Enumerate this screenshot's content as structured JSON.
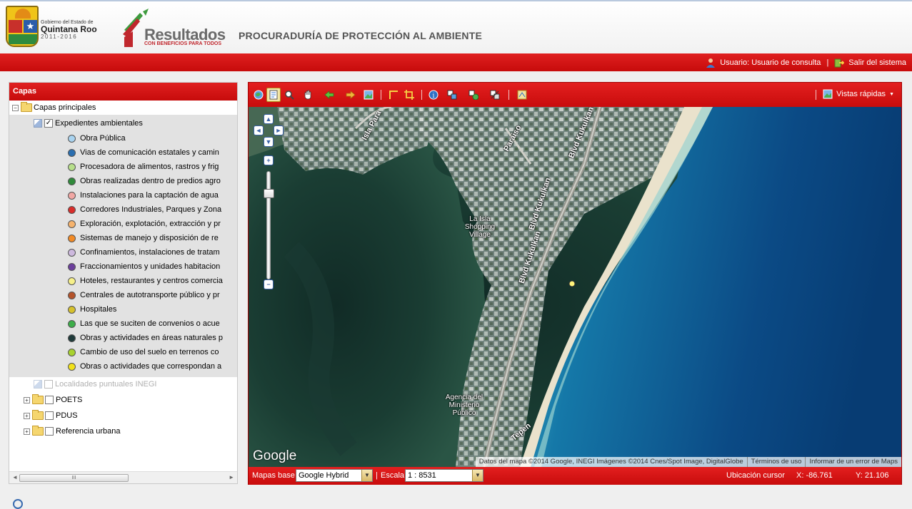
{
  "header": {
    "gov_line1": "Gobierno del Estado de",
    "gov_line2": "Quintana Roo",
    "gov_line3": "2011-2016",
    "brand_title": "Resultados",
    "brand_sub": "CON BENEFICIOS PARA TODOS",
    "agency": "PROCURADURÍA DE PROTECCIÓN AL AMBIENTE"
  },
  "userbar": {
    "user_label": "Usuario: Usuario de consulta",
    "separator": "|",
    "logout_label": "Salir del sistema"
  },
  "layers": {
    "title": "Capas",
    "root": "Capas principales",
    "group": "Expedientes ambientales",
    "items": [
      {
        "label": "Obra Pública",
        "color": "#a9d3ef"
      },
      {
        "label": "Vias de comunicación estatales y camin",
        "color": "#2b6fb0"
      },
      {
        "label": "Procesadora de alimentos, rastros y frig",
        "color": "#b7df8b"
      },
      {
        "label": "Obras realizadas dentro de predios agro",
        "color": "#2f8a3a"
      },
      {
        "label": "Instalaciones para la captación de agua",
        "color": "#f1a7a4"
      },
      {
        "label": "Corredores Industriales, Parques y Zona",
        "color": "#d92d2a"
      },
      {
        "label": "Exploración, explotación, extracción y pr",
        "color": "#f6b36d"
      },
      {
        "label": "Sistemas de manejo y disposición de re",
        "color": "#f28a25"
      },
      {
        "label": "Confinamientos, instalaciones de tratam",
        "color": "#cdb9de"
      },
      {
        "label": "Fraccionamientos y unidades habitacion",
        "color": "#6c3f9c"
      },
      {
        "label": "Hoteles, restaurantes y centros comercia",
        "color": "#f6f08a"
      },
      {
        "label": "Centrales de autotransporte público y pr",
        "color": "#b5532a"
      },
      {
        "label": "Hospitales",
        "color": "#d6c12d"
      },
      {
        "label": "Las que se suciten de convenios o acue",
        "color": "#3dae4a"
      },
      {
        "label": "Obras y actividades en áreas naturales p",
        "color": "#1f3a3a"
      },
      {
        "label": "Cambio de uso del suelo en terrenos co",
        "color": "#a8d22e"
      },
      {
        "label": "Obras o actividades que correspondan a",
        "color": "#f2e21a"
      }
    ],
    "disabled_layer": "Localidades puntuales INEGI",
    "folders": [
      "POETS",
      "PDUS",
      "Referencia urbana"
    ],
    "scroll_thumb": "III"
  },
  "map": {
    "quick_views": "Vistas rápidas",
    "labels": {
      "isla_parad": "Isla Para",
      "paraiso": "Paraiso",
      "blvd1": "Blvd Kukulkan",
      "blvd2": "Blvd Kukulkan",
      "blvd3": "Blvd Kukulkan",
      "shopping": "La Isla Shopping Village",
      "agencia": "Agencia del Ministerio Público",
      "tepen": "Tepen"
    },
    "google": "Google",
    "attribution": "Datos del mapa ©2014 Google, INEGI Imágenes ©2014 Cnes/Spot Image, DigitalGlobe",
    "terms": "Términos de uso",
    "report": "Informar de un error de Maps"
  },
  "footer": {
    "base_label": "Mapas base",
    "base_value": "Google Hybrid",
    "scale_label": "Escala",
    "scale_value": "1 : 8531",
    "cursor_label": "Ubicación cursor",
    "x_value": "X: -86.761",
    "y_value": "Y: 21.106"
  }
}
